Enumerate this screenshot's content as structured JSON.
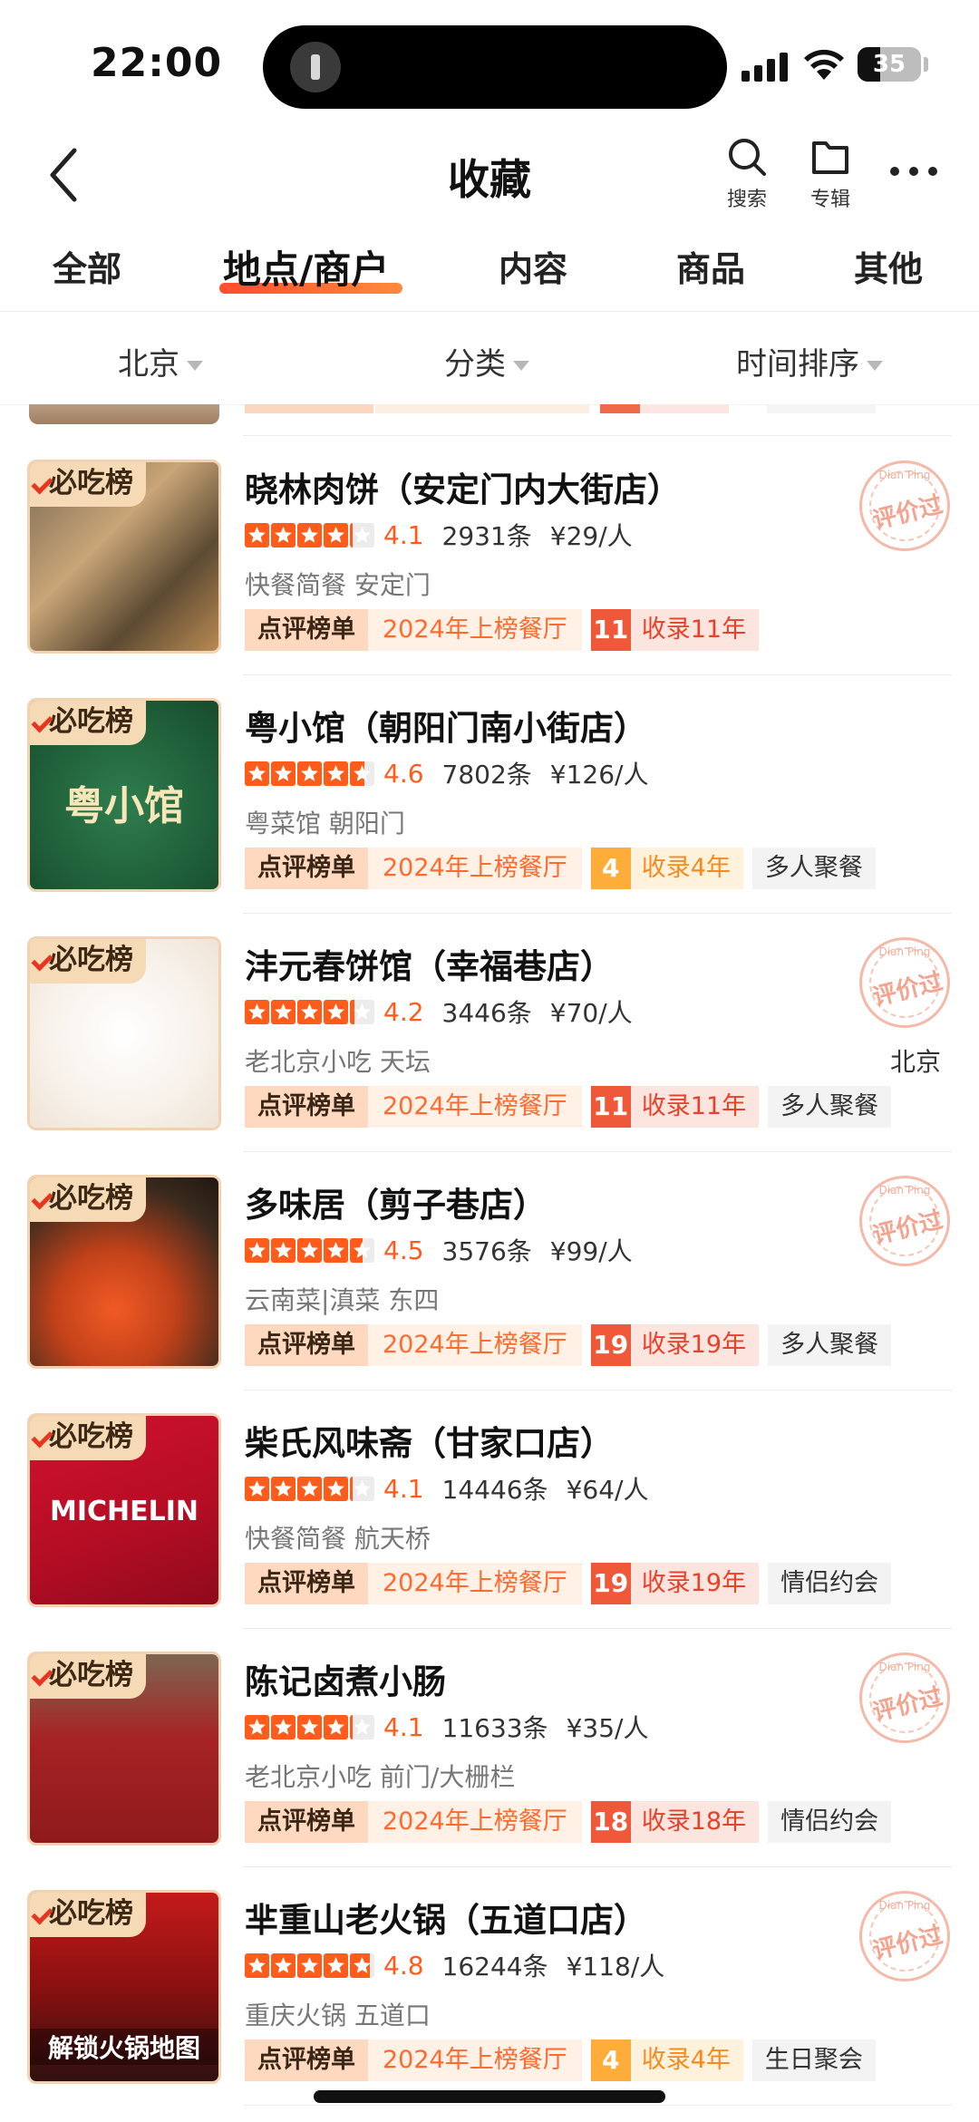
{
  "status_bar": {
    "time": "22:00",
    "battery": "35",
    "battery_level": 0.35
  },
  "nav": {
    "title": "收藏",
    "search_label": "搜索",
    "album_label": "专辑"
  },
  "tabs": [
    "全部",
    "地点/商户",
    "内容",
    "商品",
    "其他"
  ],
  "filters": [
    "北京",
    "分类",
    "时间排序"
  ],
  "badge_label": "必吃榜",
  "stamp": {
    "top": "Dian Ping",
    "main": "评价过"
  },
  "colors": {
    "accent": "#ff5b1a",
    "brand_orange": "#ff6a2f",
    "star_empty": "#ececec"
  },
  "items": [
    {
      "name": "晓林肉饼（安定门内大街店）",
      "score": "4.1",
      "rating": 4.1,
      "reviews": "2931条",
      "price": "¥29/人",
      "meta": "快餐简餐 安定门",
      "region": "",
      "board": "点评榜单",
      "year_tag": "2024年上榜餐厅",
      "years_num": "11",
      "years_text": "收录11年",
      "years_style": "red",
      "scene": "",
      "stamp": true,
      "pic_text": ""
    },
    {
      "name": "粤小馆（朝阳门南小街店）",
      "score": "4.6",
      "rating": 4.6,
      "reviews": "7802条",
      "price": "¥126/人",
      "meta": "粤菜馆 朝阳门",
      "region": "",
      "board": "点评榜单",
      "year_tag": "2024年上榜餐厅",
      "years_num": "4",
      "years_text": "收录4年",
      "years_style": "orange",
      "scene": "多人聚餐",
      "stamp": false,
      "pic_text": "粤小馆"
    },
    {
      "name": "沣元春饼馆（幸福巷店）",
      "score": "4.2",
      "rating": 4.2,
      "reviews": "3446条",
      "price": "¥70/人",
      "meta": "老北京小吃 天坛",
      "region": "北京",
      "board": "点评榜单",
      "year_tag": "2024年上榜餐厅",
      "years_num": "11",
      "years_text": "收录11年",
      "years_style": "red",
      "scene": "多人聚餐",
      "stamp": true,
      "pic_text": ""
    },
    {
      "name": "多味居（剪子巷店）",
      "score": "4.5",
      "rating": 4.5,
      "reviews": "3576条",
      "price": "¥99/人",
      "meta": "云南菜|滇菜 东四",
      "region": "",
      "board": "点评榜单",
      "year_tag": "2024年上榜餐厅",
      "years_num": "19",
      "years_text": "收录19年",
      "years_style": "red",
      "scene": "多人聚餐",
      "stamp": true,
      "pic_text": ""
    },
    {
      "name": "柴氏风味斋（甘家口店）",
      "score": "4.1",
      "rating": 4.1,
      "reviews": "14446条",
      "price": "¥64/人",
      "meta": "快餐简餐 航天桥",
      "region": "",
      "board": "点评榜单",
      "year_tag": "2024年上榜餐厅",
      "years_num": "19",
      "years_text": "收录19年",
      "years_style": "red",
      "scene": "情侣约会",
      "stamp": false,
      "pic_text": "MICHELIN"
    },
    {
      "name": "陈记卤煮小肠",
      "score": "4.1",
      "rating": 4.1,
      "reviews": "11633条",
      "price": "¥35/人",
      "meta": "老北京小吃 前门/大栅栏",
      "region": "",
      "board": "点评榜单",
      "year_tag": "2024年上榜餐厅",
      "years_num": "18",
      "years_text": "收录18年",
      "years_style": "red",
      "scene": "情侣约会",
      "stamp": true,
      "pic_text": ""
    },
    {
      "name": "芈重山老火锅（五道口店）",
      "score": "4.8",
      "rating": 4.8,
      "reviews": "16244条",
      "price": "¥118/人",
      "meta": "重庆火锅 五道口",
      "region": "",
      "board": "点评榜单",
      "year_tag": "2024年上榜餐厅",
      "years_num": "4",
      "years_text": "收录4年",
      "years_style": "orange",
      "scene": "生日聚会",
      "stamp": true,
      "pic_text": "解锁火锅地图"
    }
  ]
}
